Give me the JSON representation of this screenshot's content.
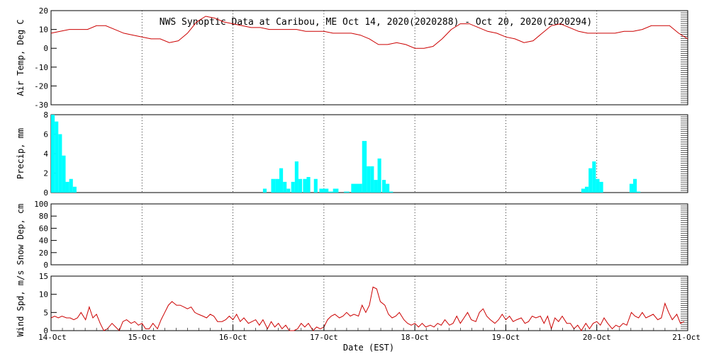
{
  "chart_data": [
    {
      "type": "line",
      "title": "NWS Synoptic Data at Caribou, ME   Oct 14, 2020(2020288) - Oct 20, 2020(2020294)",
      "ylabel": "Air Temp, Deg C",
      "ylim": [
        -30,
        20
      ],
      "yticks": [
        "20",
        "10",
        "0",
        "-10",
        "-20",
        "-30"
      ],
      "color": "#cc0000",
      "x": [
        0,
        0.1,
        0.2,
        0.3,
        0.4,
        0.5,
        0.6,
        0.7,
        0.8,
        0.9,
        1.0,
        1.1,
        1.2,
        1.3,
        1.4,
        1.5,
        1.6,
        1.7,
        1.8,
        1.9,
        2.0,
        2.1,
        2.2,
        2.3,
        2.4,
        2.5,
        2.6,
        2.7,
        2.8,
        2.9,
        3.0,
        3.1,
        3.2,
        3.3,
        3.4,
        3.5,
        3.6,
        3.7,
        3.8,
        3.9,
        4.0,
        4.1,
        4.2,
        4.3,
        4.4,
        4.5,
        4.6,
        4.7,
        4.8,
        4.9,
        5.0,
        5.1,
        5.2,
        5.3,
        5.4,
        5.5,
        5.6,
        5.7,
        5.8,
        5.9,
        6.0,
        6.1,
        6.2,
        6.3,
        6.4,
        6.5,
        6.6,
        6.7,
        6.8,
        6.9,
        7.0
      ],
      "values": [
        8,
        9,
        10,
        10,
        10,
        12,
        12,
        10,
        8,
        7,
        6,
        5,
        5,
        3,
        4,
        8,
        14,
        17,
        16,
        14,
        13,
        12,
        11,
        11,
        10,
        10,
        10,
        10,
        9,
        9,
        9,
        8,
        8,
        8,
        7,
        5,
        2,
        2,
        3,
        2,
        0,
        0,
        1,
        5,
        10,
        13,
        13,
        11,
        9,
        8,
        6,
        5,
        3,
        4,
        8,
        12,
        13,
        11,
        9,
        8,
        8,
        8,
        8,
        9,
        9,
        10,
        12,
        12,
        12,
        8,
        5
      ]
    },
    {
      "type": "bar",
      "ylabel": "Precip, mm",
      "ylim": [
        0,
        8
      ],
      "yticks": [
        "8",
        "6",
        "4",
        "2",
        "0"
      ],
      "color": "#00ffff",
      "x": [
        0.0,
        0.04,
        0.08,
        0.12,
        0.16,
        0.2,
        0.24,
        2.33,
        2.42,
        2.47,
        2.51,
        2.55,
        2.59,
        2.64,
        2.68,
        2.72,
        2.77,
        2.81,
        2.89,
        2.95,
        3.05,
        3.1,
        3.22,
        3.3,
        3.42,
        3.47,
        3.51,
        3.55,
        3.59,
        3.64,
        3.68,
        3.72,
        5.83,
        5.87,
        5.91,
        5.95,
        5.99,
        6.03,
        6.36,
        6.4,
        6.44
      ],
      "widths": [
        0.04,
        0.04,
        0.04,
        0.04,
        0.04,
        0.04,
        0.04,
        0.04,
        0.05,
        0.04,
        0.04,
        0.04,
        0.04,
        0.04,
        0.04,
        0.04,
        0.04,
        0.04,
        0.04,
        0.1,
        0.05,
        0.06,
        0.06,
        0.12,
        0.05,
        0.04,
        0.04,
        0.04,
        0.04,
        0.04,
        0.04,
        0.04,
        0.04,
        0.04,
        0.04,
        0.04,
        0.04,
        0.04,
        0.04,
        0.04,
        0.04
      ],
      "values": [
        8,
        7.3,
        6,
        3.8,
        1.1,
        1.4,
        0.6,
        0.4,
        1.4,
        1.4,
        2.5,
        1.1,
        0.4,
        1.1,
        3.2,
        1.4,
        1.4,
        1.6,
        1.4,
        0.4,
        0.1,
        0.4,
        0.1,
        0.9,
        5.3,
        2.7,
        2.7,
        1.3,
        3.5,
        1.3,
        0.9,
        0.1,
        0.4,
        0.6,
        2.5,
        3.2,
        1.4,
        1.1,
        0.9,
        1.4,
        0.1
      ]
    },
    {
      "type": "line",
      "ylabel": "Snow Dep, cm",
      "ylim": [
        0,
        100
      ],
      "yticks": [
        "100",
        "80",
        "60",
        "40",
        "20",
        "0"
      ],
      "x": [],
      "values": []
    },
    {
      "type": "line",
      "ylabel": "Wind Spd, m/s",
      "xlabel": "Date (EST)",
      "ylim": [
        0,
        15
      ],
      "yticks": [
        "15",
        "10",
        "5",
        "0"
      ],
      "categories": [
        "14-Oct",
        "15-Oct",
        "16-Oct",
        "17-Oct",
        "18-Oct",
        "19-Oct",
        "20-Oct",
        "21-Oct"
      ],
      "color": "#cc0000",
      "x": [
        0.0,
        0.04,
        0.08,
        0.12,
        0.17,
        0.21,
        0.25,
        0.29,
        0.33,
        0.38,
        0.42,
        0.46,
        0.5,
        0.54,
        0.58,
        0.62,
        0.67,
        0.71,
        0.75,
        0.79,
        0.83,
        0.88,
        0.92,
        0.96,
        1.0,
        1.04,
        1.08,
        1.12,
        1.17,
        1.21,
        1.25,
        1.29,
        1.33,
        1.38,
        1.42,
        1.46,
        1.5,
        1.54,
        1.58,
        1.62,
        1.67,
        1.71,
        1.75,
        1.79,
        1.83,
        1.88,
        1.92,
        1.96,
        2.0,
        2.04,
        2.08,
        2.12,
        2.17,
        2.21,
        2.25,
        2.29,
        2.33,
        2.38,
        2.42,
        2.46,
        2.5,
        2.54,
        2.58,
        2.62,
        2.67,
        2.71,
        2.75,
        2.79,
        2.83,
        2.88,
        2.92,
        2.96,
        3.0,
        3.04,
        3.08,
        3.12,
        3.17,
        3.21,
        3.25,
        3.29,
        3.33,
        3.38,
        3.42,
        3.46,
        3.5,
        3.54,
        3.58,
        3.62,
        3.67,
        3.71,
        3.75,
        3.79,
        3.83,
        3.88,
        3.92,
        3.96,
        4.0,
        4.04,
        4.08,
        4.12,
        4.17,
        4.21,
        4.25,
        4.29,
        4.33,
        4.38,
        4.42,
        4.46,
        4.5,
        4.54,
        4.58,
        4.62,
        4.67,
        4.71,
        4.75,
        4.79,
        4.83,
        4.88,
        4.92,
        4.96,
        5.0,
        5.04,
        5.08,
        5.12,
        5.17,
        5.21,
        5.25,
        5.29,
        5.33,
        5.38,
        5.42,
        5.46,
        5.5,
        5.54,
        5.58,
        5.62,
        5.67,
        5.71,
        5.75,
        5.79,
        5.83,
        5.88,
        5.92,
        5.96,
        6.0,
        6.04,
        6.08,
        6.12,
        6.17,
        6.21,
        6.25,
        6.29,
        6.33,
        6.38,
        6.42,
        6.46,
        6.5,
        6.54,
        6.58,
        6.62,
        6.67,
        6.71,
        6.75,
        6.79,
        6.83,
        6.88,
        6.92,
        6.96,
        7.0
      ],
      "values": [
        3.5,
        4,
        3.5,
        4,
        3.5,
        3.5,
        3,
        3.5,
        5,
        3,
        6.5,
        3.5,
        4.5,
        2,
        0,
        0.5,
        2,
        1,
        -0.5,
        2.5,
        3,
        2,
        2.5,
        1.5,
        2,
        0.5,
        0.5,
        2,
        0.5,
        3,
        5,
        7,
        8,
        7,
        7,
        6.5,
        6,
        6.5,
        5,
        4.5,
        4,
        3.5,
        4.5,
        4,
        2.5,
        2.5,
        3,
        4,
        3,
        4.5,
        2.5,
        3.5,
        2,
        2.5,
        3,
        1.5,
        3,
        0.5,
        2.5,
        1,
        2,
        0.5,
        1.5,
        0,
        0,
        0.5,
        2,
        1,
        2,
        0,
        1,
        0.5,
        1,
        3,
        4,
        4.5,
        3.5,
        4,
        5,
        4,
        4.5,
        4,
        7,
        5,
        7,
        12,
        11.5,
        8,
        7,
        4.5,
        3.5,
        4,
        5,
        3,
        2,
        1.5,
        2,
        1,
        2,
        1,
        1.5,
        1,
        2,
        1.5,
        3,
        1.5,
        2,
        4,
        2,
        3.5,
        5,
        3,
        2.5,
        5,
        6,
        4,
        3,
        2,
        3,
        4.5,
        3,
        4,
        2.5,
        3,
        3.5,
        2,
        2.5,
        4,
        3.5,
        4,
        2,
        4,
        0.5,
        3.5,
        2.5,
        4,
        2,
        2,
        0.5,
        1.5,
        0,
        2,
        0.5,
        2,
        2.5,
        1.5,
        3.5,
        2,
        0.5,
        1.5,
        1,
        2,
        1.5,
        5,
        4,
        3.5,
        5,
        3.5,
        4,
        4.5,
        3,
        3.5,
        7.5,
        5,
        3,
        4.5,
        2,
        2.5
      ]
    }
  ]
}
